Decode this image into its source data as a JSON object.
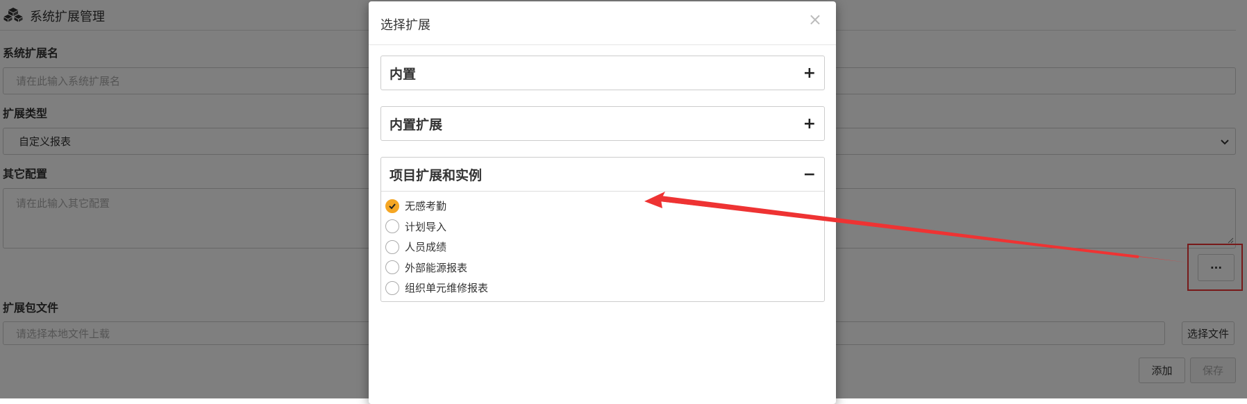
{
  "header": {
    "title": "系统扩展管理",
    "icon": "cubes-icon"
  },
  "form": {
    "name_label": "系统扩展名",
    "name_placeholder": "请在此输入系统扩展名",
    "type_label": "扩展类型",
    "type_value": "自定义报表",
    "config_label": "其它配置",
    "config_placeholder": "请在此输入其它配置",
    "more_button": "···",
    "package_label": "扩展包文件",
    "package_placeholder": "请选择本地文件上载",
    "choose_file_button": "选择文件",
    "add_button": "添加",
    "save_button": "保存"
  },
  "modal": {
    "title": "选择扩展",
    "close_symbol": "×",
    "panels": [
      {
        "label": "内置",
        "toggle": "+",
        "expanded": false
      },
      {
        "label": "内置扩展",
        "toggle": "+",
        "expanded": false
      },
      {
        "label": "项目扩展和实例",
        "toggle": "−",
        "expanded": true,
        "options": [
          {
            "label": "无感考勤",
            "checked": true
          },
          {
            "label": "计划导入",
            "checked": false
          },
          {
            "label": "人员成绩",
            "checked": false
          },
          {
            "label": "外部能源报表",
            "checked": false
          },
          {
            "label": "组织单元维修报表",
            "checked": false
          }
        ]
      }
    ]
  },
  "colors": {
    "accent": "#f5a623",
    "annotation": "#ee3333",
    "backdrop": "rgba(0,0,0,0.5)"
  }
}
